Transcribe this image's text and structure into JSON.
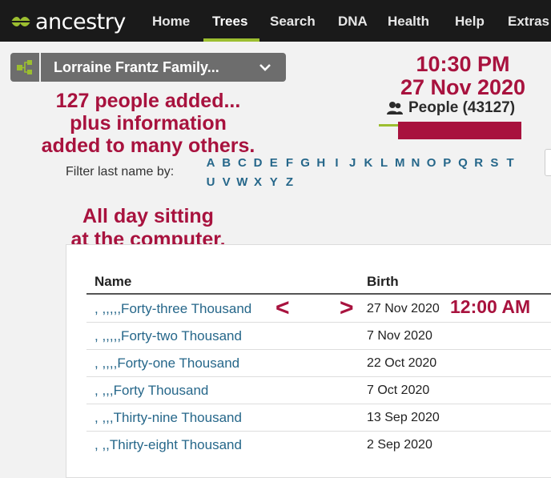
{
  "nav": {
    "logo_text": "ancestry",
    "items": [
      {
        "label": "Home"
      },
      {
        "label": "Trees"
      },
      {
        "label": "Search"
      },
      {
        "label": "DNA"
      },
      {
        "label": "Health"
      },
      {
        "label": "Help"
      },
      {
        "label": "Extras"
      }
    ],
    "active": "Trees"
  },
  "tree_selector": {
    "label": "Lorraine Frantz Family...",
    "tree_icon": "family-tree-icon",
    "chevron_icon": "chevron-down-icon"
  },
  "annotations": {
    "time": "10:30 PM",
    "date": "27 Nov 2020",
    "added_line1": "127 people added...",
    "added_line2": "plus information",
    "added_line3": "added to many others.",
    "day_line1": "All day sitting",
    "day_line2": "at the computer.",
    "left_arrow": "<",
    "right_arrow": ">",
    "midnight": "12:00 AM"
  },
  "people": {
    "label": "People (43127)",
    "icon": "people-icon"
  },
  "filter": {
    "label": "Filter last name by:",
    "letters": [
      "A",
      "B",
      "C",
      "D",
      "E",
      "F",
      "G",
      "H",
      "I",
      "J",
      "K",
      "L",
      "M",
      "N",
      "O",
      "P",
      "Q",
      "R",
      "S",
      "T",
      "U",
      "V",
      "W",
      "X",
      "Y",
      "Z"
    ]
  },
  "table": {
    "headers": {
      "name": "Name",
      "birth": "Birth"
    },
    "rows": [
      {
        "name": ", ,,,,,Forty-three Thousand",
        "birth": "27 Nov 2020"
      },
      {
        "name": ", ,,,,,Forty-two Thousand",
        "birth": "7 Nov 2020"
      },
      {
        "name": ", ,,,,Forty-one Thousand",
        "birth": "22 Oct 2020"
      },
      {
        "name": ", ,,,Forty Thousand",
        "birth": "7 Oct 2020"
      },
      {
        "name": ", ,,,Thirty-nine Thousand",
        "birth": "13 Sep 2020"
      },
      {
        "name": ", ,,Thirty-eight Thousand",
        "birth": "2 Sep 2020"
      }
    ]
  },
  "colors": {
    "nav_bg": "#1a1a1a",
    "accent_green": "#9cbe30",
    "annotation_red": "#a8123e",
    "link_blue": "#26678a"
  }
}
